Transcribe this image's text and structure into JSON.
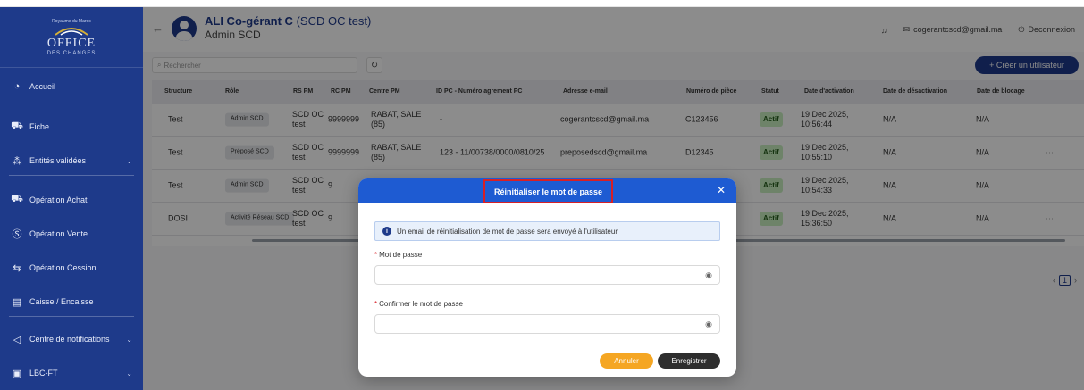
{
  "logo": {
    "tagline": "Royaume du Maroc",
    "name": "OFFICE",
    "sub": "DES CHANGES"
  },
  "sidebar": {
    "items": [
      {
        "label": "Accueil",
        "icon": "dashboard-icon"
      },
      {
        "label": "Fiche",
        "icon": "cart-icon"
      },
      {
        "label": "Entités validées",
        "icon": "entities-icon"
      },
      {
        "label": "Opération Achat",
        "icon": "cart-icon"
      },
      {
        "label": "Opération Vente",
        "icon": "dollar-icon"
      },
      {
        "label": "Opération Cession",
        "icon": "transfer-icon"
      },
      {
        "label": "Caisse / Encaisse",
        "icon": "cash-register-icon"
      },
      {
        "label": "Centre de notifications",
        "icon": "notification-icon"
      },
      {
        "label": "LBC-FT",
        "icon": "document-icon"
      }
    ]
  },
  "header": {
    "user_name": "ALI Co-gérant C",
    "user_org": "(SCD OC test)",
    "user_role": "Admin SCD",
    "email": "cogerantcscd@gmail.ma",
    "logout": "Deconnexion"
  },
  "toolbar": {
    "search_placeholder": "Rechercher",
    "create_label": "+ Créer un utilisateur"
  },
  "table": {
    "columns": [
      "Structure",
      "Rôle",
      "RS PM",
      "RC PM",
      "Centre PM",
      "ID PC - Numéro agrement PC",
      "Adresse e-mail",
      "Numéro de pièce",
      "Statut",
      "Date d'activation",
      "Date de désactivation",
      "Date de blocage"
    ],
    "rows": [
      {
        "structure": "Test",
        "role": "Admin SCD",
        "rs_pm": "SCD OC test",
        "rc_pm": "9999999",
        "centre_pm": "RABAT, SALE (85)",
        "id_pc": "-",
        "email": "cogerantcscd@gmail.ma",
        "piece": "C123456",
        "statut": "Actif",
        "activation": "19 Dec 2025, 10:56:44",
        "desactivation": "N/A",
        "blocage": "N/A"
      },
      {
        "structure": "Test",
        "role": "Préposé SCD",
        "rs_pm": "SCD OC test",
        "rc_pm": "9999999",
        "centre_pm": "RABAT, SALE (85)",
        "id_pc": "123 - 11/00738/0000/0810/25",
        "email": "preposedscd@gmail.ma",
        "piece": "D12345",
        "statut": "Actif",
        "activation": "19 Dec 2025, 10:55:10",
        "desactivation": "N/A",
        "blocage": "N/A"
      },
      {
        "structure": "Test",
        "role": "Admin SCD",
        "rs_pm": "SCD OC test",
        "rc_pm": "9",
        "centre_pm": "",
        "id_pc": "",
        "email": "",
        "piece": "",
        "statut": "Actif",
        "activation": "19 Dec 2025, 10:54:33",
        "desactivation": "N/A",
        "blocage": "N/A"
      },
      {
        "structure": "DOSI",
        "role": "Activité Réseau SCD",
        "rs_pm": "SCD OC test",
        "rc_pm": "9",
        "centre_pm": "",
        "id_pc": "",
        "email": "",
        "piece": "",
        "statut": "Actif",
        "activation": "19 Dec 2025, 15:36:50",
        "desactivation": "N/A",
        "blocage": "N/A"
      }
    ],
    "more": "···"
  },
  "pagination": {
    "current": "1"
  },
  "modal": {
    "title": "Réinitialiser le mot de passe",
    "info": "Un email de réinitialisation de mot de passe sera envoyé à l'utilisateur.",
    "password_label": "Mot de passe",
    "confirm_label": "Confirmer le mot de passe",
    "cancel": "Annuler",
    "save": "Enregistrer"
  }
}
